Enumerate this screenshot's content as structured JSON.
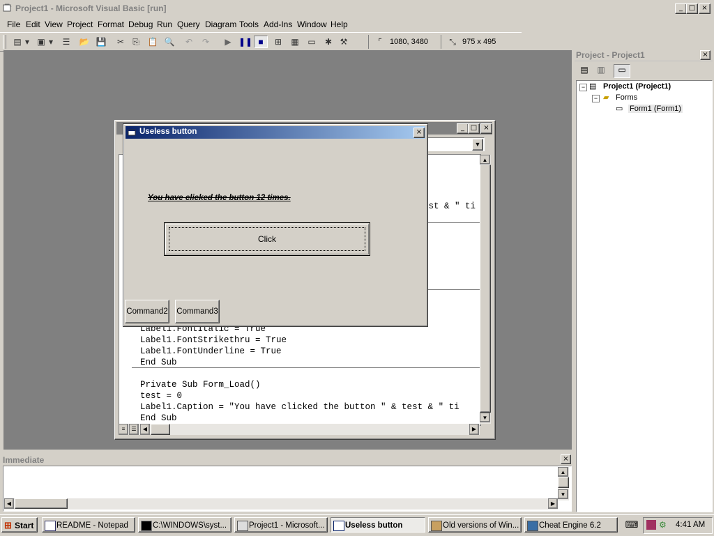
{
  "window": {
    "title": "Project1 - Microsoft Visual Basic [run]"
  },
  "menu": [
    "File",
    "Edit",
    "View",
    "Project",
    "Format",
    "Debug",
    "Run",
    "Query",
    "Diagram",
    "Tools",
    "Add-Ins",
    "Window",
    "Help"
  ],
  "toolbar": {
    "position": "1080, 3480",
    "size": "975 x 495"
  },
  "project_explorer": {
    "title": "Project - Project1",
    "root": "Project1 (Project1)",
    "folder": "Forms",
    "form": "Form1 (Form1)"
  },
  "code": {
    "partial_line_1": "est & \" ti",
    "lines_bottom": [
      "Label1.FontItalic = True",
      "Label1.FontStrikethru = True",
      "Label1.FontUnderline = True",
      "End Sub"
    ],
    "lines_load": [
      "Private Sub Form_Load()",
      "test = 0",
      "Label1.Caption = \"You have clicked the button \" & test & \" ti",
      "End Sub"
    ]
  },
  "form": {
    "title": "Useless button",
    "label": "You have clicked the button 12 times.",
    "click_button": "Click",
    "command2": "Command2",
    "command3": "Command3"
  },
  "immediate": {
    "title": "Immediate"
  },
  "taskbar": {
    "start": "Start",
    "tasks": [
      "README - Notepad",
      "C:\\WINDOWS\\syst...",
      "Project1 - Microsoft...",
      "Useless button",
      "Old versions of Win...",
      "Cheat Engine 6.2"
    ],
    "clock": "4:41 AM"
  },
  "colors": {
    "title_active": "#0a246a",
    "title_gradient_end": "#a6caf0",
    "face": "#d4d0c8",
    "mdi_background": "#808080"
  }
}
